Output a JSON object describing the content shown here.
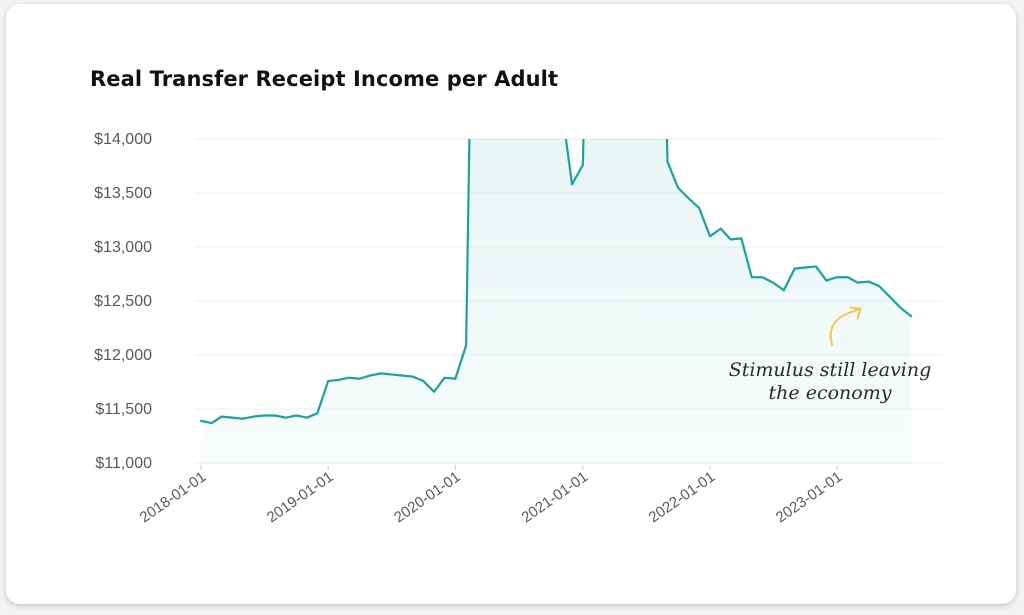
{
  "chart_data": {
    "type": "area",
    "title": "Real Transfer Receipt Income per Adult",
    "xlabel": "",
    "ylabel": "",
    "ylim": [
      11000,
      14000
    ],
    "yticks": [
      11000,
      11500,
      12000,
      12500,
      13000,
      13500,
      14000
    ],
    "ytick_labels": [
      "$11,000",
      "$11,500",
      "$12,000",
      "$12,500",
      "$13,000",
      "$13,500",
      "$14,000"
    ],
    "xlim": [
      "2018-01-01",
      "2023-08-01"
    ],
    "xtick_labels": [
      "2018-01-01",
      "2019-01-01",
      "2020-01-01",
      "2021-01-01",
      "2022-01-01",
      "2023-01-01"
    ],
    "grid": true,
    "series": [
      {
        "color": "#1aa39a",
        "x": [
          "2018-01-01",
          "2018-02-01",
          "2018-03-01",
          "2018-04-01",
          "2018-05-01",
          "2018-06-01",
          "2018-07-01",
          "2018-08-01",
          "2018-09-01",
          "2018-10-01",
          "2018-11-01",
          "2018-12-01",
          "2019-01-01",
          "2019-02-01",
          "2019-03-01",
          "2019-04-01",
          "2019-05-01",
          "2019-06-01",
          "2019-07-01",
          "2019-08-01",
          "2019-09-01",
          "2019-10-01",
          "2019-11-01",
          "2019-12-01",
          "2020-01-01",
          "2020-02-01",
          "2020-03-01",
          "2020-04-01",
          "2020-05-01",
          "2020-06-01",
          "2020-07-01",
          "2020-08-01",
          "2020-09-01",
          "2020-10-01",
          "2020-11-01",
          "2020-12-01",
          "2021-01-01",
          "2021-02-01",
          "2021-03-01",
          "2021-04-01",
          "2021-05-01",
          "2021-06-01",
          "2021-07-01",
          "2021-08-01",
          "2021-09-01",
          "2021-10-01",
          "2021-11-01",
          "2021-12-01",
          "2022-01-01",
          "2022-02-01",
          "2022-03-01",
          "2022-04-01",
          "2022-05-01",
          "2022-06-01",
          "2022-07-01",
          "2022-08-01",
          "2022-09-01",
          "2022-10-01",
          "2022-11-01",
          "2022-12-01",
          "2023-01-01",
          "2023-02-01",
          "2023-03-01",
          "2023-04-01",
          "2023-05-01",
          "2023-06-01",
          "2023-07-01",
          "2023-08-01"
        ],
        "values": [
          11390,
          11370,
          11430,
          11420,
          11410,
          11430,
          11440,
          11440,
          11420,
          11440,
          11420,
          11460,
          11760,
          11770,
          11790,
          11780,
          11810,
          11830,
          11820,
          11810,
          11800,
          11760,
          11660,
          11790,
          11780,
          12090,
          18000,
          18000,
          18000,
          18000,
          18000,
          18000,
          18000,
          18000,
          14300,
          13580,
          13760,
          18000,
          18000,
          18000,
          18000,
          18000,
          18000,
          18000,
          13790,
          13550,
          13450,
          13360,
          13100,
          13170,
          13070,
          13080,
          12720,
          12720,
          12670,
          12600,
          12800,
          12810,
          12820,
          12690,
          12720,
          12720,
          12670,
          12680,
          12640,
          12540,
          12440,
          12360
        ]
      }
    ],
    "annotations": [
      {
        "text_lines": [
          "Stimulus still leaving",
          "the economy"
        ],
        "target_x": "2023-04-01",
        "target_y": 12540
      }
    ]
  }
}
